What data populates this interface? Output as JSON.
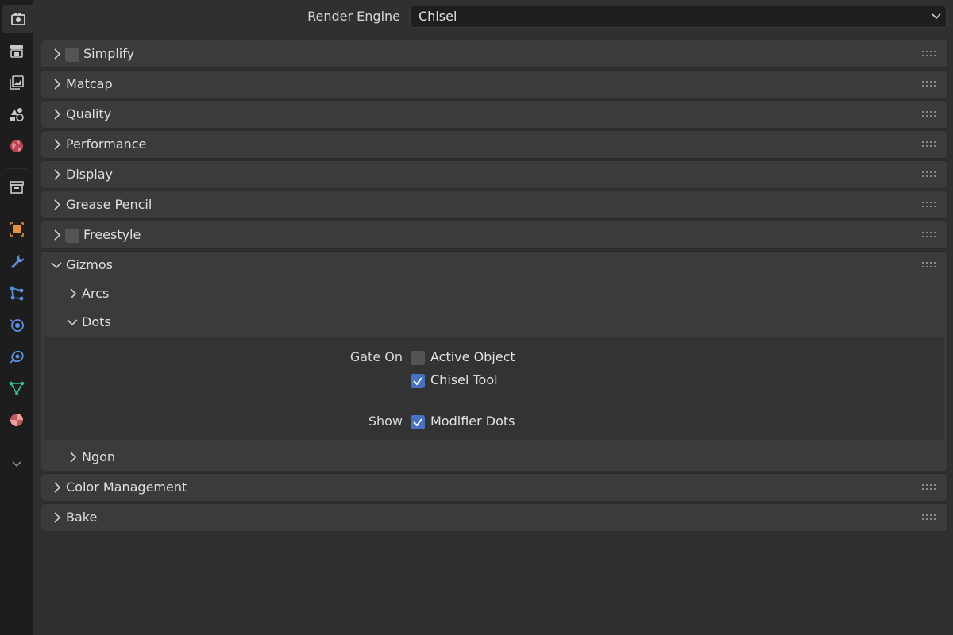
{
  "tabs": [
    {
      "name": "render-tab-icon",
      "active": true,
      "color": "#d0d0d0"
    },
    {
      "name": "output-tab-icon",
      "color": "#c8c8c8"
    },
    {
      "name": "view-layer-tab-icon",
      "color": "#c8c8c8"
    },
    {
      "name": "scene-tab-icon",
      "color": "#c8c8c8"
    },
    {
      "name": "world-tab-icon",
      "color": "#d05c6c"
    },
    {
      "name": "collection-tab-icon",
      "color": "#c8c8c8"
    },
    {
      "name": "object-tab-icon",
      "color": "#e8913a"
    },
    {
      "name": "modifier-tab-icon",
      "color": "#5a8fe0"
    },
    {
      "name": "particles-tab-icon",
      "color": "#5a8fe0"
    },
    {
      "name": "physics-tab-icon",
      "color": "#5a8fe0"
    },
    {
      "name": "constraints-tab-icon",
      "color": "#5a8fe0"
    },
    {
      "name": "data-tab-icon",
      "color": "#2fc38f"
    },
    {
      "name": "material-tab-icon",
      "color": "#d06a6a"
    },
    {
      "name": "more-tabs-icon",
      "color": "#8a8a8a"
    }
  ],
  "render_engine": {
    "label": "Render Engine",
    "value": "Chisel"
  },
  "panels": {
    "simplify": {
      "title": "Simplify",
      "has_checkbox": true
    },
    "matcap": {
      "title": "Matcap"
    },
    "quality": {
      "title": "Quality"
    },
    "performance": {
      "title": "Performance"
    },
    "display": {
      "title": "Display"
    },
    "grease_pencil": {
      "title": "Grease Pencil"
    },
    "freestyle": {
      "title": "Freestyle",
      "has_checkbox": true
    },
    "gizmos": {
      "title": "Gizmos",
      "subpanels": {
        "arcs": {
          "title": "Arcs"
        },
        "dots": {
          "title": "Dots",
          "gate_on_label": "Gate On",
          "active_object_label": "Active Object",
          "active_object_checked": false,
          "chisel_tool_label": "Chisel Tool",
          "chisel_tool_checked": true,
          "show_label": "Show",
          "modifier_dots_label": "Modifier Dots",
          "modifier_dots_checked": true
        },
        "ngon": {
          "title": "Ngon"
        }
      }
    },
    "color_management": {
      "title": "Color Management"
    },
    "bake": {
      "title": "Bake"
    }
  },
  "colors": {
    "checkbox_on": "#4772c4",
    "checkbox_off": "#545454"
  }
}
